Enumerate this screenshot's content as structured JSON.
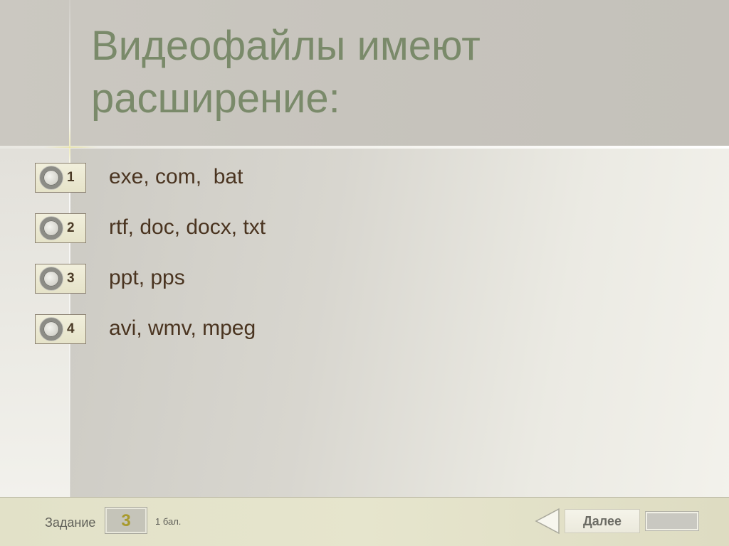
{
  "question": {
    "title": "Видеофайлы имеют расширение:"
  },
  "options": [
    {
      "number": "1",
      "label": "exe, com,  bat"
    },
    {
      "number": "2",
      "label": "rtf, doc, docx, txt"
    },
    {
      "number": "3",
      "label": "ppt, pps"
    },
    {
      "number": "4",
      "label": "avi, wmv, mpeg"
    }
  ],
  "footer": {
    "task_label": "Задание",
    "task_number": "3",
    "points": "1 бал.",
    "next_label": "Далее"
  },
  "colors": {
    "title": "#7a8a6a",
    "option_text": "#4a3420",
    "task_number": "#a89a2c",
    "footer_bg": "#e4e3ca"
  },
  "icons": {
    "radio": "radio-circle-icon",
    "prev": "triangle-left-icon"
  }
}
